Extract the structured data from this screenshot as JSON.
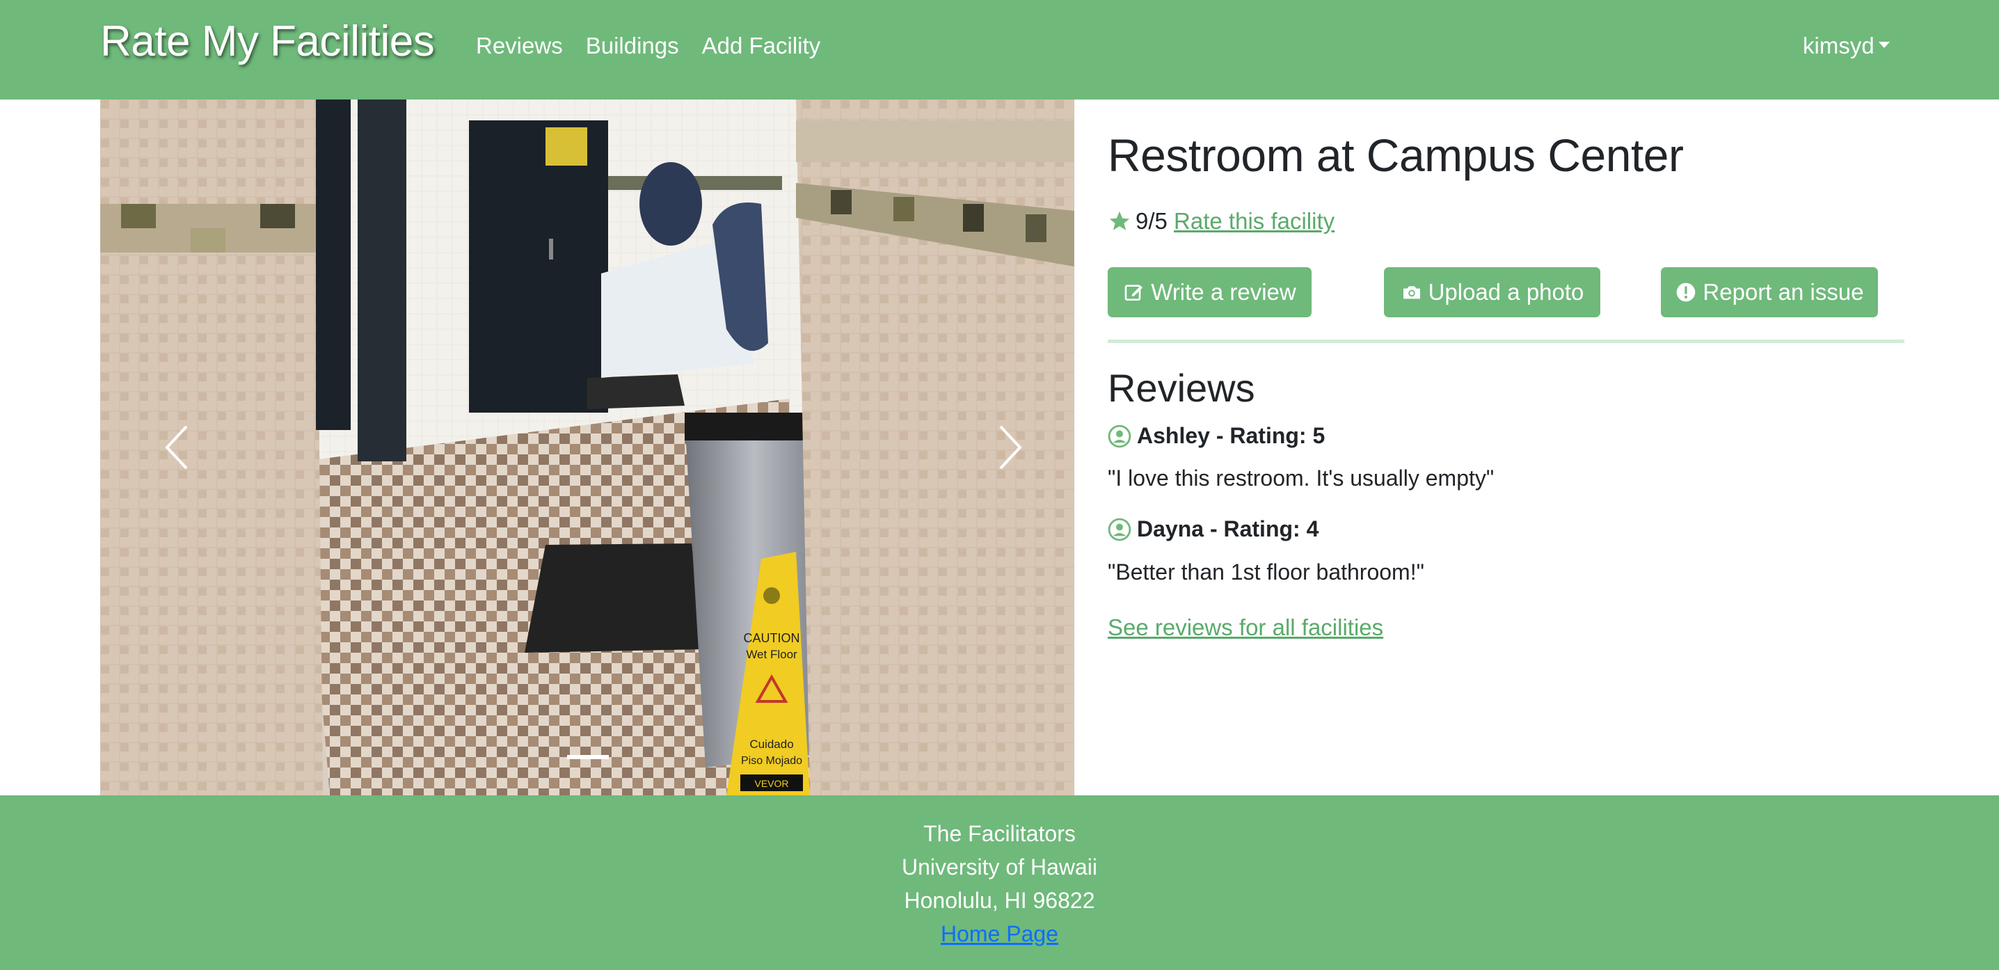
{
  "navbar": {
    "brand": "Rate My Facilities",
    "links": [
      "Reviews",
      "Buildings",
      "Add Facility"
    ],
    "user": "kimsyd",
    "color": "#6fb97b"
  },
  "carousel": {
    "image": "restroom-photo",
    "slide_count": 1,
    "active_slide": 1,
    "sign_text": [
      "CAUTION",
      "Wet Floor",
      "Cuidado",
      "Piso Mojado",
      "VEVOR"
    ]
  },
  "facility": {
    "title": "Restroom at Campus Center",
    "rating": "9/5",
    "rate_link": "Rate this facility",
    "buttons": {
      "write": "Write a review",
      "upload": "Upload a photo",
      "report": "Report an issue"
    }
  },
  "reviews": {
    "heading": "Reviews",
    "items": [
      {
        "author_line": "Ashley - Rating: 5",
        "text": "\"I love this restroom. It's usually empty\""
      },
      {
        "author_line": "Dayna - Rating: 4",
        "text": "\"Better than 1st floor bathroom!\""
      }
    ],
    "all_link": "See reviews for all facilities"
  },
  "footer": {
    "team": "The Facilitators",
    "university": "University of Hawaii",
    "address": "Honolulu, HI 96822",
    "home_link": "Home Page"
  },
  "colors": {
    "accent": "#6fb97b",
    "link": "#5aaa6a",
    "footer_link": "#0d6efd"
  }
}
